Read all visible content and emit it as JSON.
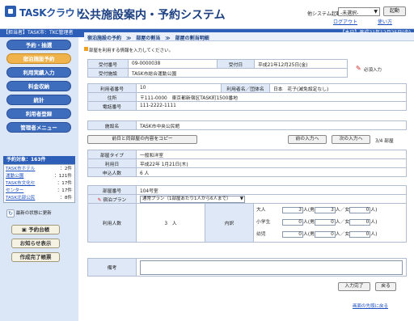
{
  "header": {
    "logo": "TASKクラウド",
    "title": "公共施設案内・予約システム",
    "sys_start_label": "他システム起動:",
    "sys_select": "-未選択-",
    "start_button": "起動",
    "logout": "ログアウト",
    "help": "使い方"
  },
  "bar": {
    "user_info": "【担当者】TASK市：TKC管理者",
    "today": "【本日】平成21年12月25日(金)"
  },
  "sidebar": {
    "nav": [
      "予約・抽選",
      "宿泊施設予約",
      "利用実績入力",
      "料金収納",
      "統計",
      "利用者登録",
      "管理者メニュー"
    ],
    "reservations_title": "予約対象：163件",
    "reservations": [
      {
        "name": "TASK市ホテル",
        "count": "：2件"
      },
      {
        "name": "運動公園",
        "count": "：121件"
      },
      {
        "name": "TASK市文化セ",
        "count": "：17件"
      },
      {
        "name": "センター",
        "count": "：17件"
      },
      {
        "name": "TASK北部公民",
        "count": "：8件"
      }
    ],
    "refresh": "最新の状態に更新",
    "buttons": [
      "予約台帳",
      "お知らせ表示",
      "作成完了帳票"
    ]
  },
  "main": {
    "breadcrumb": "宿泊施設の予約　≫　部屋の割当　≫　部屋の割当明細",
    "notice": "部屋を利用する情報を入力してください。",
    "required": "必須入力",
    "basic": {
      "receipt_no_label": "受付番号",
      "receipt_no": "09-0000038",
      "receipt_date_label": "受付日",
      "receipt_date": "平成21年12月25日(金)",
      "facility_label": "受付施設",
      "facility": "TASK市総合運動公園"
    },
    "user": {
      "user_no_label": "利用者番号",
      "user_no": "10",
      "user_name_label": "利用者名／団体名",
      "user_name": "日本　花子(減免設定なし)",
      "address_label": "住所",
      "address": "〒111-0000　東京都新宿区TASK町1500番地",
      "phone_label": "電話番号",
      "phone": "111-2222-1111"
    },
    "facility_name_label": "施設名",
    "facility_name": "TASK市中央公民館",
    "copy_button": "前日と同部屋の内容をコピー",
    "prev_button": "前の入力へ",
    "next_button": "次の入力へ",
    "room_count": "3/4 部屋",
    "room": {
      "type_label": "部屋タイプ",
      "type": "一般和洋室",
      "date_label": "利用日",
      "date": "平成22年 1月21日(木)",
      "count_label": "申込人数",
      "count": "6 人"
    },
    "detail": {
      "room_no_label": "部屋番号",
      "room_no": "104号室",
      "plan_label": "宿泊プラン",
      "plan": "通常プラン（1部屋あたり1人から6人まで）",
      "persons_label": "利用人数",
      "persons": "3　人",
      "breakdown_label": "内訳",
      "rows": [
        {
          "label": "大人",
          "total": "3",
          "male": "3",
          "female": "0"
        },
        {
          "label": "小学生",
          "total": "0",
          "male": "0",
          "female": "0"
        },
        {
          "label": "幼児",
          "total": "0",
          "male": "0",
          "female": "0"
        }
      ],
      "unit_person": "人",
      "paren_male": "(男",
      "slash_female": "人／女",
      "paren_close": "人)"
    },
    "remarks_label": "備考",
    "complete_button": "入力完了",
    "back_button": "戻る",
    "top_link": "画面の先頭に戻る"
  }
}
